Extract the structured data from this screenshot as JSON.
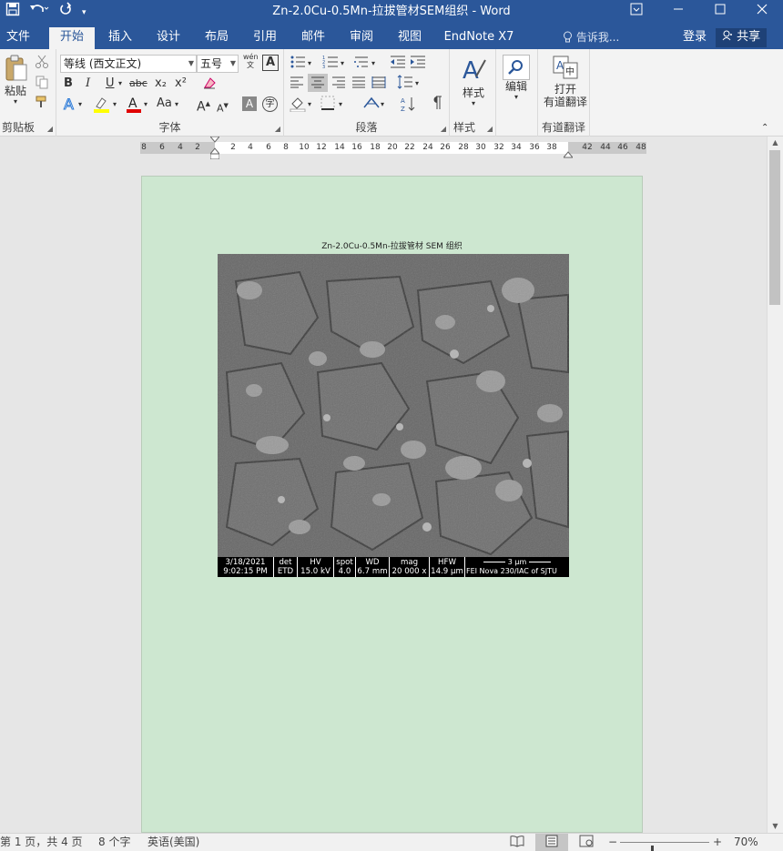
{
  "window": {
    "title": "Zn-2.0Cu-0.5Mn-拉拔管材SEM组织 - Word",
    "qat": {
      "save_icon": "save-icon",
      "undo_icon": "undo-icon",
      "redo_icon": "redo-icon",
      "customize_icon": "customize-icon"
    },
    "controls": {
      "ribbon_display": "ribbon-display-icon",
      "minimize": "minimize-icon",
      "maximize": "maximize-icon",
      "close": "close-icon"
    }
  },
  "tabs": [
    "文件",
    "开始",
    "插入",
    "设计",
    "布局",
    "引用",
    "邮件",
    "审阅",
    "视图",
    "EndNote X7"
  ],
  "active_tab": "开始",
  "tell_me": "告诉我...",
  "account": {
    "login": "登录",
    "share": "共享"
  },
  "ribbon": {
    "clipboard": {
      "paste": "粘贴",
      "label": "剪贴板"
    },
    "font": {
      "name": "等线 (西文正文)",
      "size": "五号",
      "label": "字体",
      "bold": "B",
      "italic": "I",
      "underline": "U",
      "strike": "abc",
      "subscript": "x₂",
      "superscript": "x²",
      "change_case": "Aa",
      "grow": "A",
      "shrink": "A",
      "phonetic": "wén"
    },
    "paragraph": {
      "label": "段落"
    },
    "styles": {
      "styles": "样式",
      "label": "样式"
    },
    "editing": {
      "editing": "编辑"
    },
    "translate": {
      "open_line1": "打开",
      "open_line2": "有道翻译",
      "label": "有道翻译"
    }
  },
  "ruler": {
    "ticks": [
      "8",
      "6",
      "4",
      "2",
      "2",
      "4",
      "6",
      "8",
      "10",
      "12",
      "14",
      "16",
      "18",
      "20",
      "22",
      "24",
      "26",
      "28",
      "30",
      "32",
      "34",
      "36",
      "38",
      "42",
      "44",
      "46",
      "48"
    ]
  },
  "document": {
    "caption": "Zn-2.0Cu-0.5Mn-拉拔管材 SEM 组织",
    "sem_data": {
      "cells": [
        {
          "top": "3/18/2021",
          "bottom": "9:02:15 PM"
        },
        {
          "top": "det",
          "bottom": "ETD"
        },
        {
          "top": "HV",
          "bottom": "15.0 kV"
        },
        {
          "top": "spot",
          "bottom": "4.0"
        },
        {
          "top": "WD",
          "bottom": "6.7 mm"
        },
        {
          "top": "mag",
          "bottom": "20 000 x"
        },
        {
          "top": "HFW",
          "bottom": "14.9 µm"
        },
        {
          "top": "3 µm",
          "bottom": "FEI Nova 230/IAC of SJTU"
        }
      ]
    }
  },
  "status": {
    "page": "第 1 页，共 4 页",
    "words": "8 个字",
    "language": "英语(美国)",
    "zoom": "70%",
    "zoom_fraction": 0.35
  }
}
